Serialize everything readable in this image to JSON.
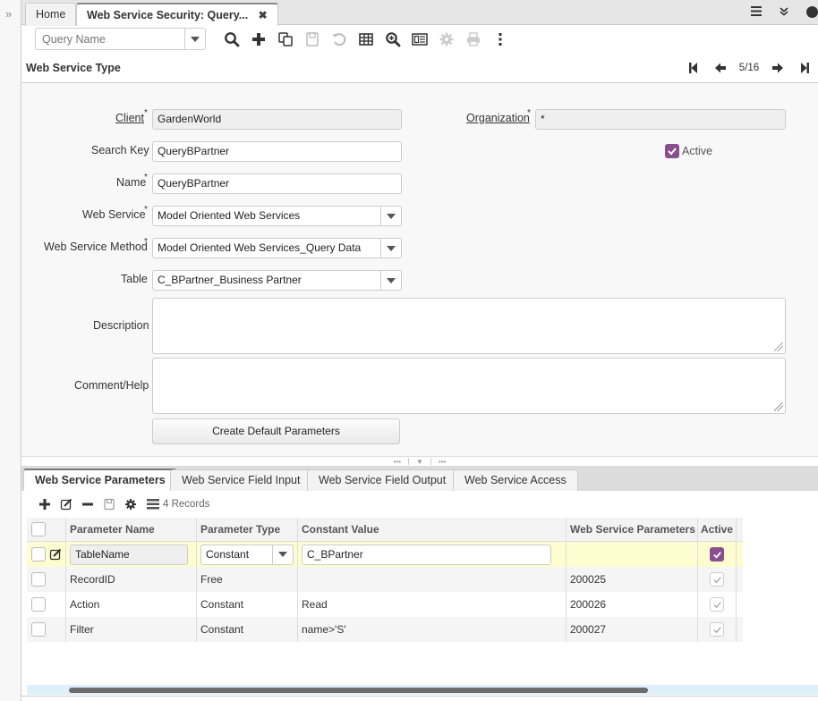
{
  "window": {
    "tabs": [
      {
        "label": "Home"
      },
      {
        "label": "Web Service Security: Query..."
      }
    ],
    "right_icons": [
      "menu-icon",
      "chevron-double-down-icon",
      "help-icon"
    ]
  },
  "toolbar": {
    "query_placeholder": "Query Name",
    "icons": [
      "search-icon",
      "new-record-icon",
      "copy-icon",
      "save-icon",
      "undo-icon",
      "grid-toggle-icon",
      "zoom-icon",
      "report-icon",
      "process-icon",
      "print-icon",
      "more-icon"
    ]
  },
  "header": {
    "title": "Web Service Type",
    "record_counter": "5/16"
  },
  "form": {
    "client": {
      "label": "Client",
      "value": "GardenWorld"
    },
    "organization": {
      "label": "Organization",
      "value": "*"
    },
    "search_key": {
      "label": "Search Key",
      "value": "QueryBPartner"
    },
    "active": {
      "label": "Active",
      "checked": true
    },
    "name": {
      "label": "Name",
      "value": "QueryBPartner"
    },
    "web_service": {
      "label": "Web Service",
      "value": "Model Oriented Web Services"
    },
    "web_service_method": {
      "label": "Web Service Method",
      "value": "Model Oriented Web Services_Query Data"
    },
    "table": {
      "label": "Table",
      "value": "C_BPartner_Business Partner"
    },
    "description": {
      "label": "Description",
      "value": ""
    },
    "comment_help": {
      "label": "Comment/Help",
      "value": ""
    },
    "create_default_button": "Create Default Parameters",
    "required_mark": "*"
  },
  "detail": {
    "tabs": [
      {
        "label": "Web Service Parameters"
      },
      {
        "label": "Web Service Field Input"
      },
      {
        "label": "Web Service Field Output"
      },
      {
        "label": "Web Service Access"
      }
    ],
    "records_label": "4 Records",
    "columns": [
      "Parameter Name",
      "Parameter Type",
      "Constant Value",
      "Web Service Parameters",
      "Active"
    ],
    "rows": [
      {
        "name": "TableName",
        "type": "Constant",
        "value": "C_BPartner",
        "param_id": "",
        "active": true,
        "editing": true
      },
      {
        "name": "RecordID",
        "type": "Free",
        "value": "",
        "param_id": "200025",
        "active": true
      },
      {
        "name": "Action",
        "type": "Constant",
        "value": "Read",
        "param_id": "200026",
        "active": true
      },
      {
        "name": "Filter",
        "type": "Constant",
        "value": "name>'S'",
        "param_id": "200027",
        "active": true
      }
    ]
  },
  "colors": {
    "accent_purple": "#8a4f8e",
    "edit_row": "#fdfdd0",
    "scrollbar_track": "#dff0fa"
  }
}
